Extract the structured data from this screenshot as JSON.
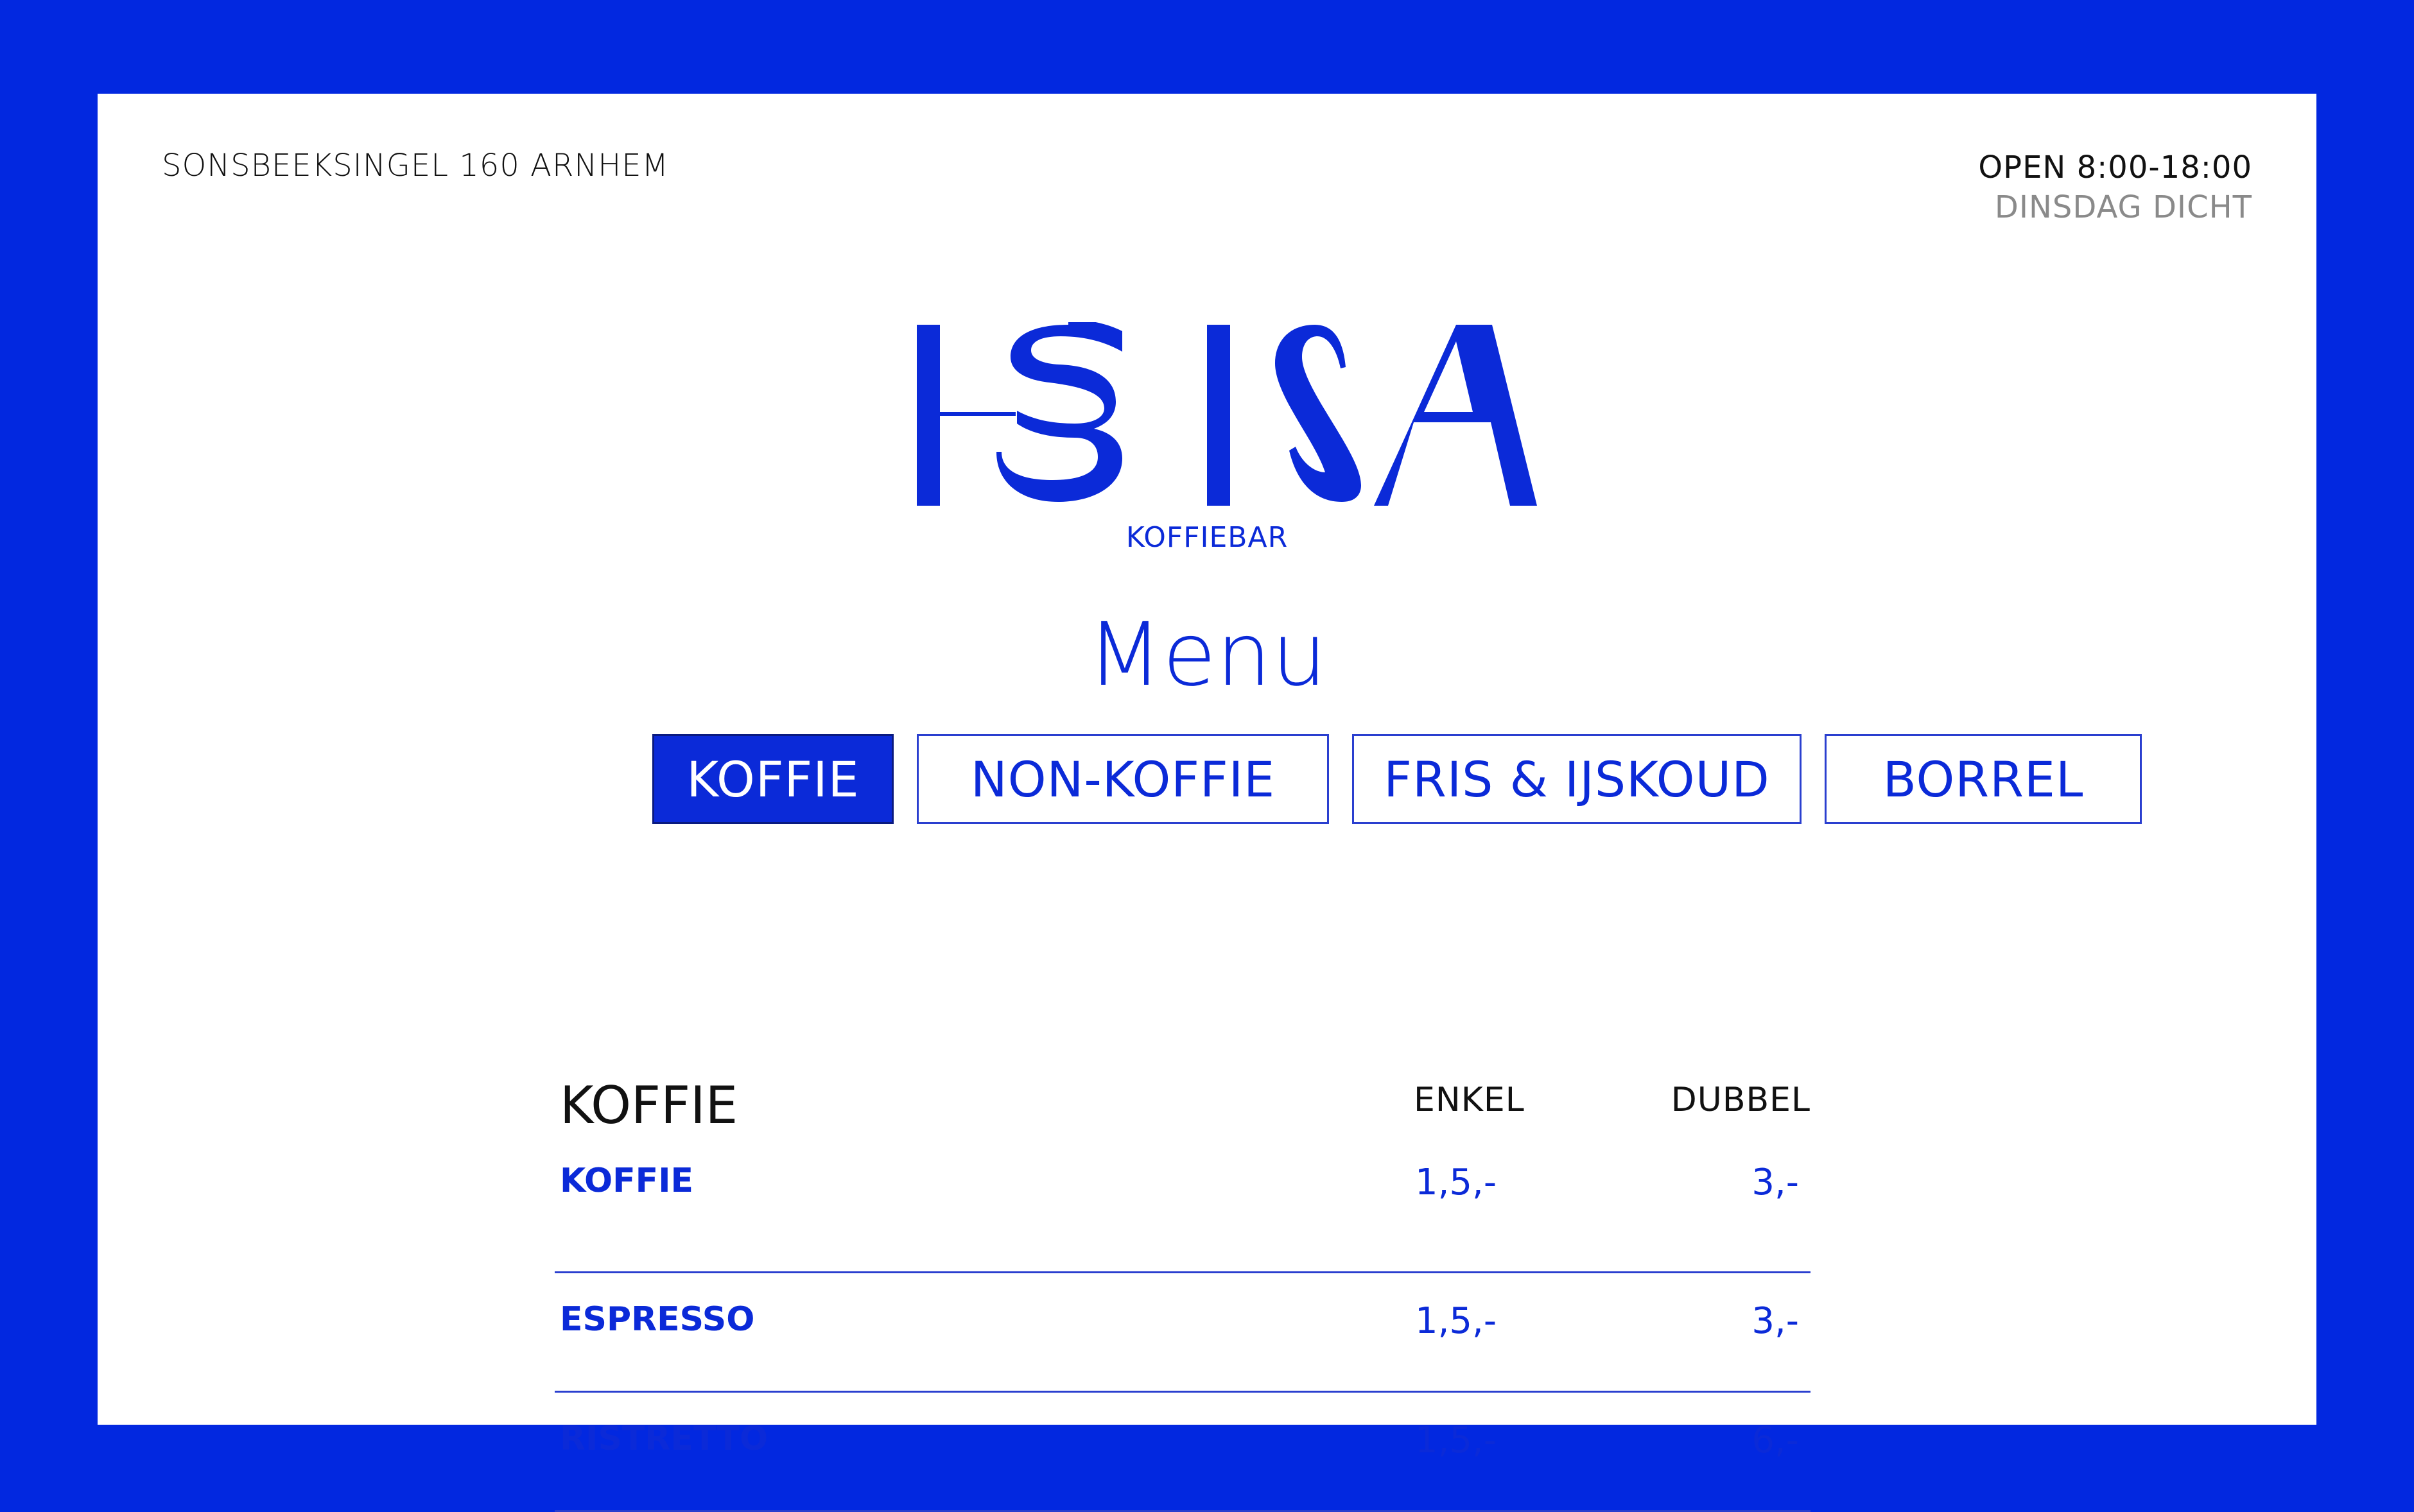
{
  "header": {
    "address": "SONSBEEKSINGEL 160 ARNHEM",
    "open_hours": "OPEN 8:00-18:00",
    "closed_day": "DINSDAG DICHT"
  },
  "brand": {
    "logo_text": "HEISA",
    "subtitle": "KOFFIEBAR",
    "color": "#0b2ad8"
  },
  "menu": {
    "title": "Menu",
    "tabs": [
      {
        "label": "KOFFIE",
        "active": true
      },
      {
        "label": "NON-KOFFIE",
        "active": false
      },
      {
        "label": "FRIS & IJSKOUD",
        "active": false
      },
      {
        "label": "BORREL",
        "active": false
      }
    ]
  },
  "section": {
    "title": "KOFFIE",
    "col_single": "ENKEL",
    "col_double": "DUBBEL",
    "items": [
      {
        "name": "KOFFIE",
        "single": "1,5,-",
        "double": "3,-"
      },
      {
        "name": "ESPRESSO",
        "single": "1,5,-",
        "double": "3,-"
      },
      {
        "name": "RISTRETTO",
        "single": "1,5,-",
        "double": "6,-"
      }
    ]
  },
  "colors": {
    "frame": "#0228e0",
    "accent": "#0b2ad8",
    "muted": "#8a8a8a"
  }
}
